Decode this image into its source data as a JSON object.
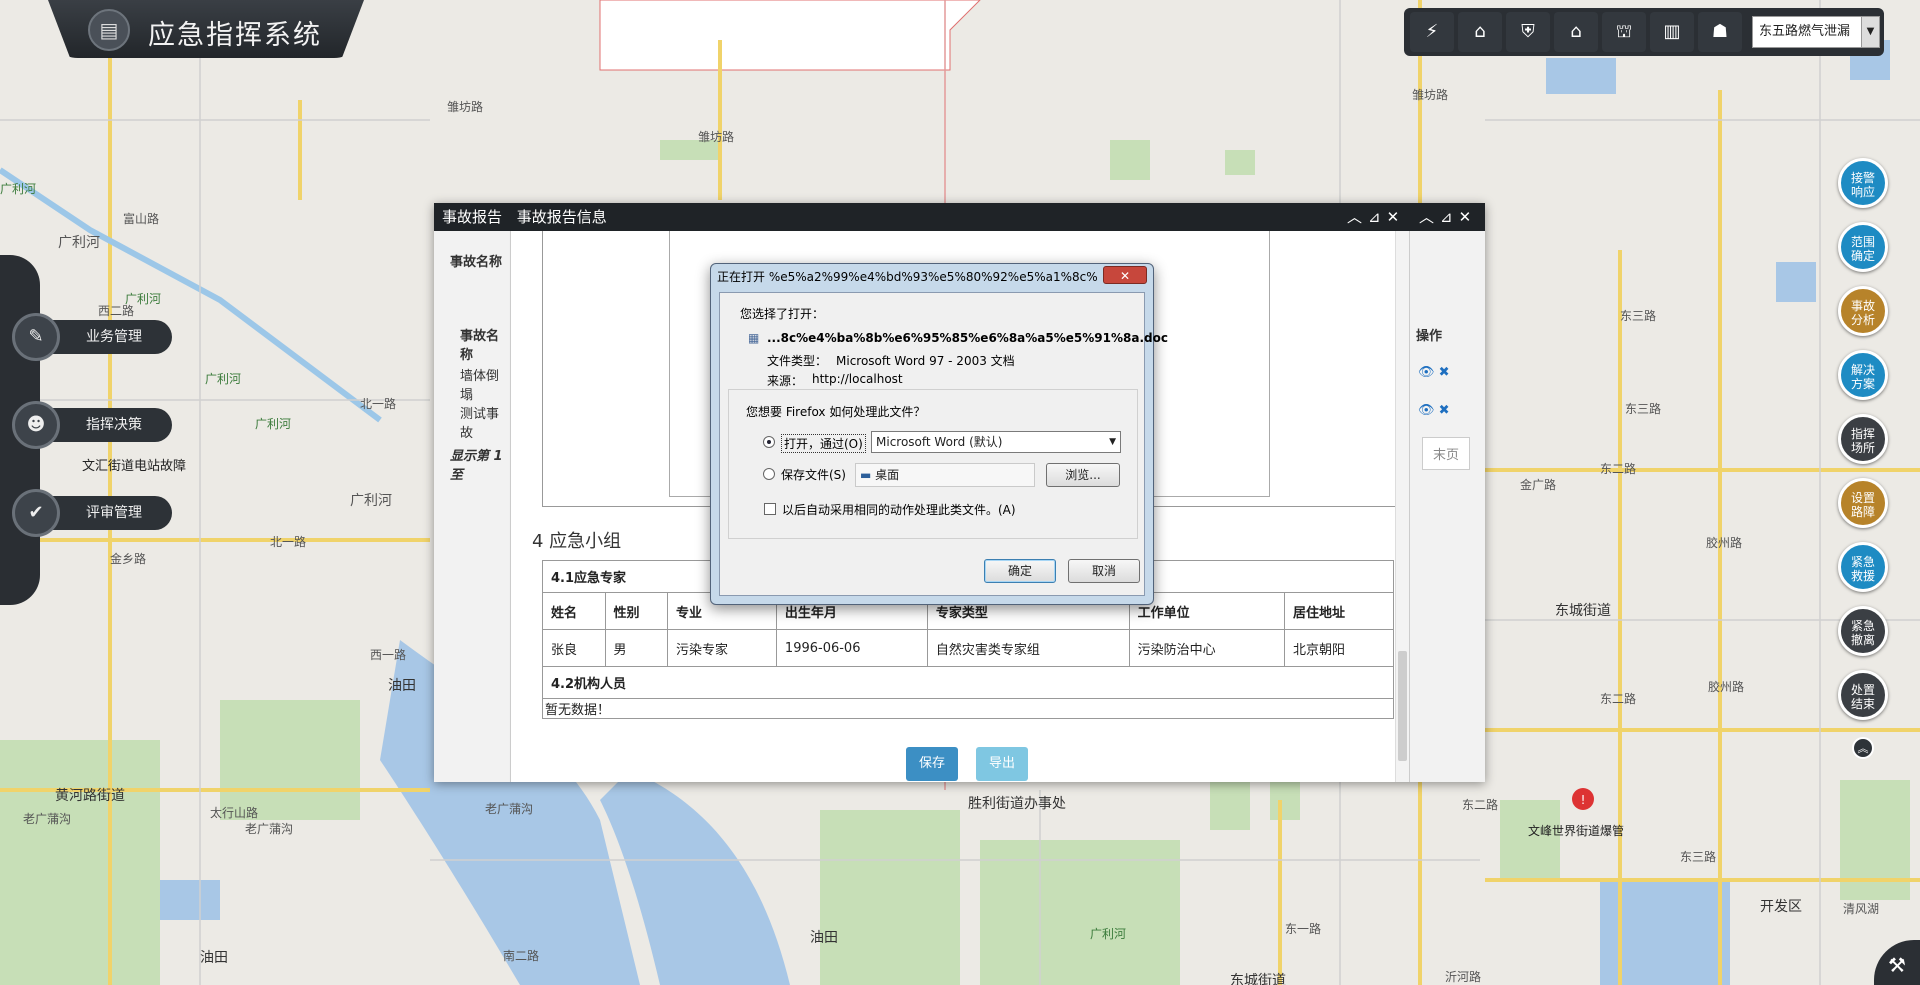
{
  "app": {
    "title": "应急指挥系统"
  },
  "toolbar": {
    "buttons": [
      "lightning-icon",
      "house-shield-icon",
      "shield-icon",
      "home-icon",
      "bank-icon",
      "building-icon",
      "people-icon"
    ],
    "incident_select": "东五路燃气泄漏"
  },
  "left_nav": [
    {
      "label": "业务管理",
      "icon": "edit-icon"
    },
    {
      "label": "指挥决策",
      "icon": "user-icon"
    },
    {
      "label": "评审管理",
      "icon": "clipboard-icon"
    }
  ],
  "right_nav": [
    {
      "line1": "接警",
      "line2": "响应",
      "color": "blue"
    },
    {
      "line1": "范围",
      "line2": "确定",
      "color": "blue"
    },
    {
      "line1": "事故",
      "line2": "分析",
      "color": "gold"
    },
    {
      "line1": "解决",
      "line2": "方案",
      "color": "blue"
    },
    {
      "line1": "指挥",
      "line2": "场所",
      "color": "gray"
    },
    {
      "line1": "设置",
      "line2": "路障",
      "color": "gold"
    },
    {
      "line1": "紧急",
      "line2": "救援",
      "color": "blue"
    },
    {
      "line1": "紧急",
      "line2": "撤离",
      "color": "gray"
    },
    {
      "line1": "处置",
      "line2": "结束",
      "color": "gray"
    }
  ],
  "map_labels": [
    "雏坊路",
    "雏坊路",
    "雏坊路",
    "广利河",
    "广利河",
    "广利河",
    "广利河",
    "广利河",
    "广利河",
    "西二路",
    "西一路",
    "北一路",
    "北一路",
    "文汇街道电站故障",
    "金乡路",
    "油田",
    "黄河路街道",
    "老广蒲沟",
    "太行山路",
    "老广蒲沟",
    "老广蒲沟",
    "油田",
    "油田",
    "南二路",
    "广利河",
    "胜利街道办事处",
    "东城街道",
    "开发区",
    "清风湖",
    "东三路",
    "东二路",
    "东二路",
    "东三路",
    "东三路",
    "胶州路",
    "胶州路",
    "文峰世界街道爆管",
    "金广路",
    "东一路",
    "沂河路",
    "东城街道",
    "东二路",
    "富山路"
  ],
  "dialog": {
    "tab1": "事故报告",
    "tab2": "事故报告信息",
    "under": {
      "name_label": "事故名称",
      "col_name": "事故名称",
      "col_ops": "操作",
      "row1": "墙体倒塌",
      "row2": "测试事故",
      "page_info": "显示第 1 至",
      "last_page": "末页"
    },
    "section4_title": "4 应急小组",
    "experts_heading": "4.1应急专家",
    "expert_columns": [
      "姓名",
      "性别",
      "专业",
      "出生年月",
      "专家类型",
      "工作单位",
      "居住地址"
    ],
    "expert_rows": [
      [
        "张良",
        "男",
        "污染专家",
        "1996-06-06",
        "自然灾害类专家组",
        "污染防治中心",
        "北京朝阳"
      ]
    ],
    "agencies_heading": "4.2机构人员",
    "no_data": "暂无数据！",
    "save_label": "保存",
    "export_label": "导出"
  },
  "firefox_dialog": {
    "title": "正在打开 %e5%a2%99%e4%bd%93%e5%80%92%e5%a1%8c%e4...",
    "close_label": "✕",
    "you_chose": "您选择了打开：",
    "filename": "...8c%e4%ba%8b%e6%95%85%e6%8a%a5%e5%91%8a.doc",
    "file_type_label": "文件类型：",
    "file_type": "Microsoft Word 97 - 2003 文档",
    "source_label": "来源：",
    "source": "http://localhost",
    "question": "您想要 Firefox 如何处理此文件？",
    "open_with_label": "打开，通过(O)",
    "open_with_app": "Microsoft Word (默认)",
    "save_file_label": "保存文件(S)",
    "save_path": "桌面",
    "browse_label": "浏览...",
    "remember_label": "以后自动采用相同的动作处理此类文件。(A)",
    "ok_label": "确定",
    "cancel_label": "取消"
  },
  "colors": {
    "accent": "#1e8bc3",
    "dark": "#22262a",
    "gold": "#b7832a"
  }
}
